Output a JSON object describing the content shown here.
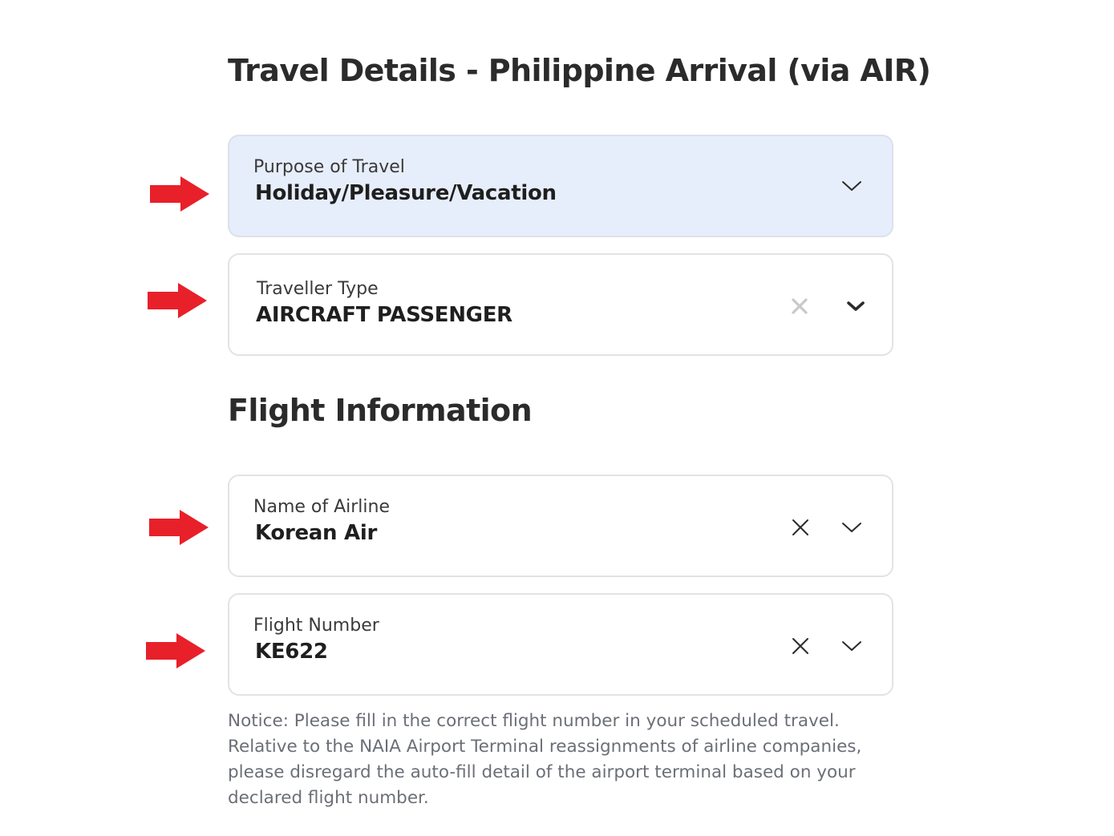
{
  "headings": {
    "travel_details": "Travel Details - Philippine Arrival (via AIR)",
    "flight_information": "Flight Information"
  },
  "fields": {
    "purpose": {
      "label": "Purpose of Travel",
      "value": "Holiday/Pleasure/Vacation"
    },
    "traveller_type": {
      "label": "Traveller Type",
      "value": "AIRCRAFT PASSENGER"
    },
    "airline": {
      "label": "Name of Airline",
      "value": "Korean Air"
    },
    "flight_number": {
      "label": "Flight Number",
      "value": "KE622"
    }
  },
  "notice": "Notice: Please fill in the correct flight number in your scheduled travel. Relative to the NAIA Airport Terminal reassignments of airline companies, please disregard the auto-fill detail of the airport terminal based on your declared flight number.",
  "icons": {
    "annotation_arrow": "right-arrow-icon",
    "clear": "close-icon",
    "dropdown": "chevron-down-icon"
  },
  "colors": {
    "highlight_background": "#e7eefb",
    "annotation_arrow": "#e8202a",
    "field_border": "#e2e3e6",
    "notice_text": "#6b6f76"
  }
}
